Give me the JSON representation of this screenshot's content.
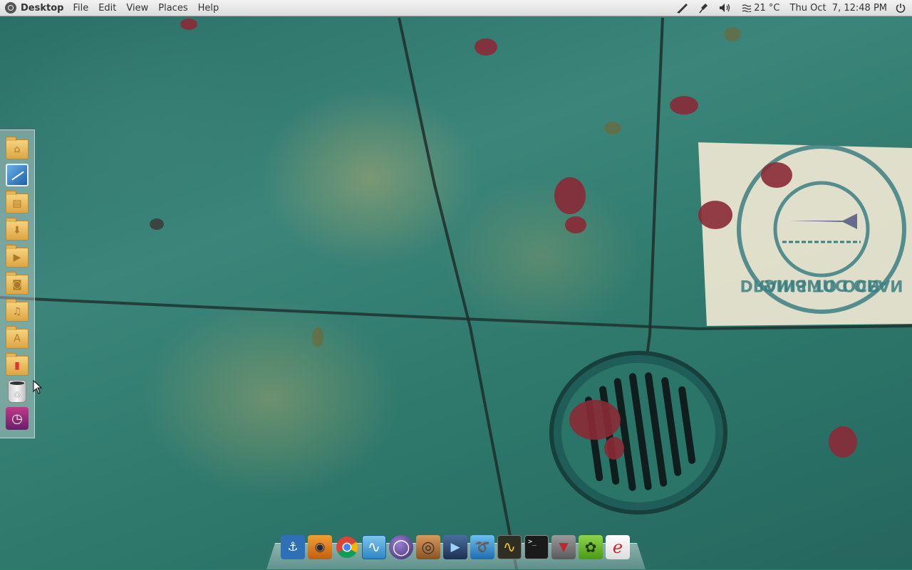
{
  "top_panel": {
    "app_name": "Desktop",
    "menu": [
      "File",
      "Edit",
      "View",
      "Places",
      "Help"
    ],
    "indicators": {
      "pen_icon": "pen-icon",
      "pin_icon": "pin-icon",
      "volume_icon": "volume-icon",
      "weather_icon": "weather-icon",
      "temperature": "21 °C",
      "clock": "Thu Oct  7, 12:48 PM",
      "power_icon": "power-icon"
    }
  },
  "left_launcher": {
    "items": [
      {
        "name": "home-folder-icon",
        "glyph": "⌂"
      },
      {
        "name": "blue-app-icon",
        "glyph": ""
      },
      {
        "name": "documents-folder-icon",
        "glyph": "▤"
      },
      {
        "name": "downloads-folder-icon",
        "glyph": "⬇"
      },
      {
        "name": "videos-folder-icon",
        "glyph": "▶"
      },
      {
        "name": "pictures-folder-icon",
        "glyph": "◙"
      },
      {
        "name": "music-folder-icon",
        "glyph": "♫"
      },
      {
        "name": "applications-folder-icon",
        "glyph": "A"
      },
      {
        "name": "bookmarks-folder-icon",
        "glyph": "▮"
      },
      {
        "name": "trash-icon",
        "glyph": "♲"
      },
      {
        "name": "time-machine-icon",
        "glyph": "◷"
      }
    ]
  },
  "dock": {
    "items": [
      {
        "name": "anchor-icon",
        "glyph": "⚓",
        "bg": "#2f6fb8"
      },
      {
        "name": "eye-icon",
        "glyph": "◉",
        "bg": "#e07a1a"
      },
      {
        "name": "chrome-icon",
        "glyph": "●",
        "bg": "#d9d9d9"
      },
      {
        "name": "activity-monitor-icon",
        "glyph": "∿",
        "bg": "#4aa3d8"
      },
      {
        "name": "orb-icon",
        "glyph": "◯",
        "bg": "#5a3f8e"
      },
      {
        "name": "speaker-icon",
        "glyph": "◎",
        "bg": "#b87a3a"
      },
      {
        "name": "movie-player-icon",
        "glyph": "▶",
        "bg": "#2c4a78"
      },
      {
        "name": "swirl-app-icon",
        "glyph": "➰",
        "bg": "#3a9ad8"
      },
      {
        "name": "system-monitor-icon",
        "glyph": "∿",
        "bg": "#3b3b2a"
      },
      {
        "name": "terminal-icon",
        "glyph": ">_",
        "bg": "#1e1e1e"
      },
      {
        "name": "settings-tie-icon",
        "glyph": "▼",
        "bg": "#7a7a7a"
      },
      {
        "name": "ubuntu-icon",
        "glyph": "✿",
        "bg": "#6cbf2a"
      },
      {
        "name": "mail-icon",
        "glyph": "e",
        "bg": "#f0f0f0"
      }
    ]
  },
  "wallpaper": {
    "stencil_text_top": "DRAINS TO OCEAN",
    "stencil_text_bottom": "NO DUMPING",
    "colors": {
      "sidewalk": "#2f7b6b",
      "stain": "#c4b06e",
      "cardboard": "#efe7d2",
      "stencil": "#3c7f82",
      "leaf": "#8a2a36"
    }
  }
}
